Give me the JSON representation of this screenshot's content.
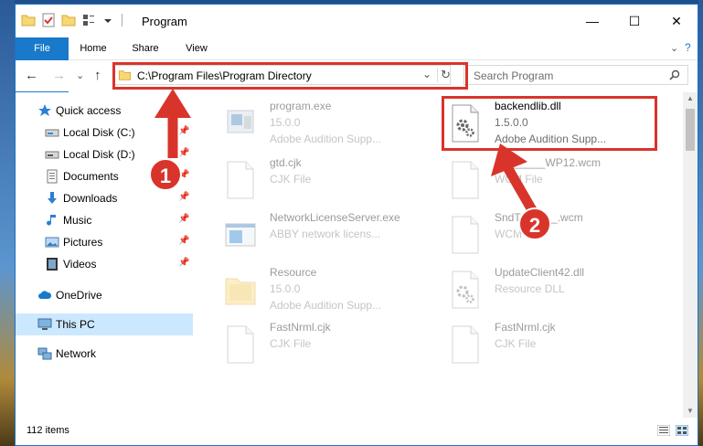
{
  "window": {
    "title": "Program",
    "minimize_glyph": "—",
    "maximize_glyph": "☐",
    "close_glyph": "✕"
  },
  "ribbon": {
    "tabs": [
      "File",
      "Home",
      "Share",
      "View"
    ]
  },
  "address_bar": {
    "path": "C:\\Program Files\\Program Directory",
    "dropdown_glyph": "⌄",
    "refresh_glyph": "↻",
    "search_placeholder": "Search Program",
    "back_glyph": "←",
    "forward_glyph": "→",
    "recent_glyph": "⌄",
    "up_glyph": "↑"
  },
  "sidebar": {
    "items": [
      {
        "label": "Quick access",
        "icon": "star-icon",
        "pinned": false
      },
      {
        "label": "Local Disk (C:)",
        "icon": "drive-icon",
        "pinned": true
      },
      {
        "label": "Local Disk (D:)",
        "icon": "drive-icon",
        "pinned": true
      },
      {
        "label": "Documents",
        "icon": "documents-icon",
        "pinned": true
      },
      {
        "label": "Downloads",
        "icon": "download-icon",
        "pinned": true
      },
      {
        "label": "Music",
        "icon": "music-icon",
        "pinned": true
      },
      {
        "label": "Pictures",
        "icon": "pictures-icon",
        "pinned": true
      },
      {
        "label": "Videos",
        "icon": "videos-icon",
        "pinned": true
      },
      {
        "label": "OneDrive",
        "icon": "cloud-icon",
        "pinned": false
      },
      {
        "label": "This PC",
        "icon": "computer-icon",
        "pinned": false
      },
      {
        "label": "Network",
        "icon": "network-icon",
        "pinned": false
      }
    ],
    "pin_glyph": "📌"
  },
  "files": [
    {
      "name": "program.exe",
      "line2": "15.0.0",
      "line3": "Adobe Audition Supp...",
      "icon": "exe-icon",
      "faded": true
    },
    {
      "name": "backendlib.dll",
      "line2": "1.5.0.0",
      "line3": "Adobe Audition Supp...",
      "icon": "dll-gear-icon",
      "faded": false
    },
    {
      "name": "gtd.cjk",
      "line2": "CJK File",
      "line3": "",
      "icon": "blank-file-icon",
      "faded": true
    },
    {
      "name": "SF______WP12.wcm",
      "line2": "WCM File",
      "line3": "",
      "icon": "blank-file-icon",
      "faded": true
    },
    {
      "name": "NetworkLicenseServer.exe",
      "line2": "ABBY network licens...",
      "line3": "",
      "icon": "window-exe-icon",
      "faded": true
    },
    {
      "name": "SndT______.wcm",
      "line2": "WCM File",
      "line3": "",
      "icon": "blank-file-icon",
      "faded": true
    },
    {
      "name": "Resource",
      "line2": "15.0.0",
      "line3": "Adobe Audition Supp...",
      "icon": "folder-icon",
      "faded": true
    },
    {
      "name": "UpdateClient42.dll",
      "line2": "Resource DLL",
      "line3": "",
      "icon": "dll-gear-icon",
      "faded": true
    },
    {
      "name": "FastNrml.cjk",
      "line2": "CJK File",
      "line3": "",
      "icon": "blank-file-icon",
      "faded": true
    },
    {
      "name": "FastNrml.cjk",
      "line2": "CJK File",
      "line3": "",
      "icon": "blank-file-icon",
      "faded": true
    }
  ],
  "status": {
    "item_count": "112 items"
  },
  "annotations": {
    "step1": "1",
    "step2": "2",
    "highlight_color": "#d9342b"
  }
}
